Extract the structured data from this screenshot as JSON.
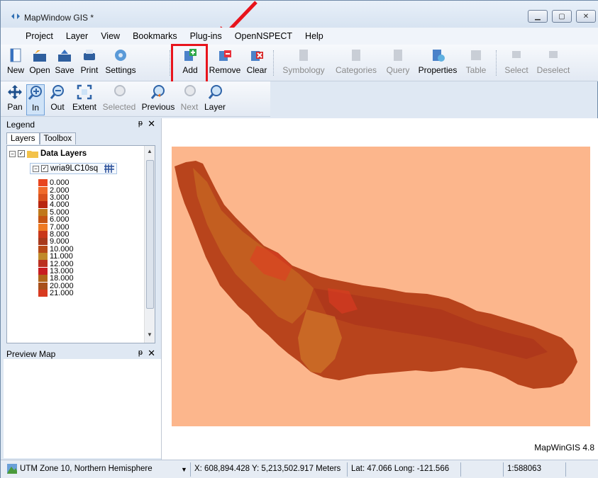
{
  "window": {
    "title": "MapWindow GIS *"
  },
  "menu": [
    "Project",
    "Layer",
    "View",
    "Bookmarks",
    "Plug-ins",
    "OpenNSPECT",
    "Help"
  ],
  "toolbar1": {
    "new": "New",
    "open": "Open",
    "save": "Save",
    "print": "Print",
    "settings": "Settings",
    "add": "Add",
    "remove": "Remove",
    "clear": "Clear",
    "symbology": "Symbology",
    "categories": "Categories",
    "query": "Query",
    "properties": "Properties",
    "table": "Table",
    "select": "Select",
    "deselect": "Deselect"
  },
  "toolbar2": {
    "pan": "Pan",
    "in": "In",
    "out": "Out",
    "extent": "Extent",
    "selected": "Selected",
    "previous": "Previous",
    "next": "Next",
    "layer": "Layer"
  },
  "legend": {
    "title": "Legend",
    "tabs": [
      "Layers",
      "Toolbox"
    ],
    "group": "Data Layers",
    "layer": "wria9LC10sq",
    "classes": [
      {
        "label": "0.000",
        "color": "#e8451e"
      },
      {
        "label": "2.000",
        "color": "#f06a2a"
      },
      {
        "label": "3.000",
        "color": "#d9501c"
      },
      {
        "label": "4.000",
        "color": "#b9260e"
      },
      {
        "label": "5.000",
        "color": "#c0781a"
      },
      {
        "label": "6.000",
        "color": "#c55412"
      },
      {
        "label": "7.000",
        "color": "#ee7a22"
      },
      {
        "label": "8.000",
        "color": "#c9381a"
      },
      {
        "label": "9.000",
        "color": "#a83a1c"
      },
      {
        "label": "10.000",
        "color": "#b84a18"
      },
      {
        "label": "11.000",
        "color": "#c08a2a"
      },
      {
        "label": "12.000",
        "color": "#bb3020"
      },
      {
        "label": "13.000",
        "color": "#c81e22"
      },
      {
        "label": "18.000",
        "color": "#b0661a"
      },
      {
        "label": "20.000",
        "color": "#a8501a"
      },
      {
        "label": "21.000",
        "color": "#d83a20"
      }
    ]
  },
  "preview": {
    "title": "Preview Map"
  },
  "map": {
    "background": "#fcb68c",
    "watermark": "MapWinGIS 4.8"
  },
  "status": {
    "projection": "UTM Zone 10, Northern Hemisphere",
    "xy": "X: 608,894.428 Y: 5,213,502.917 Meters",
    "latlong": "Lat: 47.066 Long: -121.566",
    "scale": "1:588063"
  }
}
